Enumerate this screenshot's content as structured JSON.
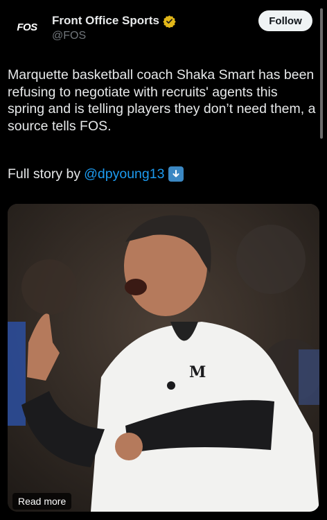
{
  "account": {
    "avatar_text": "FOS",
    "name": "Front Office Sports",
    "handle": "@FOS",
    "verified_badge_icon": "gold-check-badge-icon",
    "badge_color": "#e2b719"
  },
  "follow_label": "Follow",
  "tweet": {
    "text": "Marquette basketball coach Shaka Smart has been refusing to negotiate with recruits' agents this spring and is telling players they don’t need them, a source tells FOS.",
    "story_prefix": "Full story by",
    "mention": "@dpyoung13",
    "emoji_icon": "down-arrow-emoji-icon"
  },
  "media": {
    "read_more_label": "Read more"
  },
  "colors": {
    "link": "#1d9bf0",
    "background": "#000000",
    "text": "#e7e9ea",
    "muted": "#71767b"
  }
}
